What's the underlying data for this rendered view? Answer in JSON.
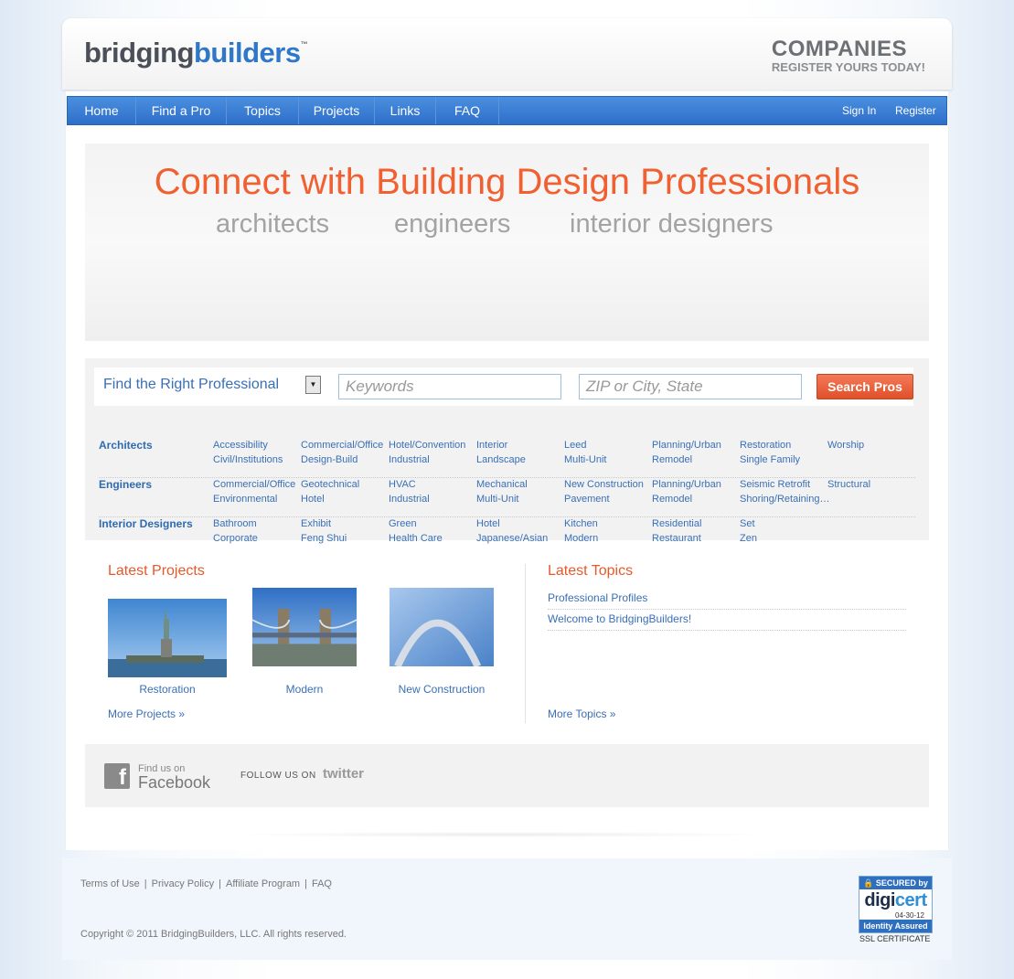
{
  "header": {
    "logo_part1": "bridging",
    "logo_part2": "builders",
    "logo_tm": "™",
    "companies_title": "COMPANIES",
    "companies_sub": "REGISTER YOURS TODAY!"
  },
  "nav": {
    "items": [
      "Home",
      "Find a Pro",
      "Topics",
      "Projects",
      "Links",
      "FAQ"
    ],
    "sign_in": "Sign In",
    "register": "Register"
  },
  "hero": {
    "title": "Connect with Building Design Professionals",
    "subtitles": [
      "architects",
      "engineers",
      "interior designers"
    ]
  },
  "search": {
    "label": "Find the Right Professional",
    "keywords_placeholder": "Keywords",
    "location_placeholder": "ZIP or City, State",
    "button": "Search Pros",
    "categories": [
      {
        "title": "Architects",
        "links": [
          "Accessibility",
          "Civil/Institutions",
          "Commercial/Office",
          "Design-Build",
          "Hotel/Convention",
          "Industrial",
          "Interior",
          "Landscape",
          "Leed",
          "Multi-Unit",
          "Planning/Urban",
          "Remodel",
          "Restoration",
          "Single Family",
          "Worship"
        ]
      },
      {
        "title": "Engineers",
        "links": [
          "Commercial/Office",
          "Environmental",
          "Geotechnical",
          "Hotel",
          "HVAC",
          "Industrial",
          "Mechanical",
          "Multi-Unit",
          "New Construction",
          "Pavement",
          "Planning/Urban",
          "Remodel",
          "Seismic Retrofit",
          "Shoring/Retaining…",
          "Structural"
        ]
      },
      {
        "title": "Interior Designers",
        "links": [
          "Bathroom",
          "Corporate",
          "Exhibit",
          "Feng Shui",
          "Green",
          "Health Care",
          "Hotel",
          "Japanese/Asian",
          "Kitchen",
          "Modern",
          "Residential",
          "Restaurant",
          "Set",
          "Zen"
        ]
      }
    ]
  },
  "latest_projects": {
    "title": "Latest Projects",
    "items": [
      "Restoration",
      "Modern",
      "New Construction"
    ],
    "more": "More Projects »"
  },
  "latest_topics": {
    "title": "Latest Topics",
    "items": [
      "Professional Profiles",
      "Welcome to BridgingBuilders!"
    ],
    "more": "More Topics »"
  },
  "social": {
    "fb_line1": "Find us on",
    "fb_line2": "Facebook",
    "follow": "FOLLOW US ON",
    "twitter": "twitter"
  },
  "footer": {
    "links": [
      "Terms of Use",
      "Privacy Policy",
      "Affiliate Program",
      "FAQ"
    ],
    "copyright": "Copyright © 2011 BridgingBuilders, LLC. All rights reserved.",
    "badge_top": "🔒 SECURED by",
    "badge_brand_a": "digi",
    "badge_brand_b": "cert",
    "badge_date": "04-30-12",
    "badge_bottom": "Identity Assured",
    "ssl": "SSL CERTIFICATE"
  }
}
